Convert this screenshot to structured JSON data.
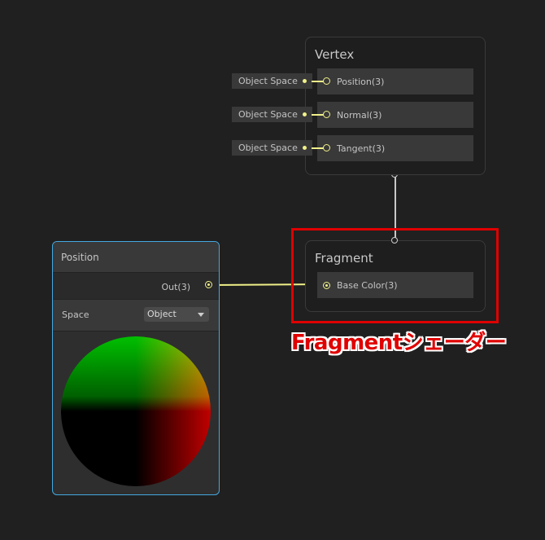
{
  "vertex_node": {
    "title": "Vertex",
    "slots": [
      {
        "label": "Position(3)",
        "input": "Object Space"
      },
      {
        "label": "Normal(3)",
        "input": "Object Space"
      },
      {
        "label": "Tangent(3)",
        "input": "Object Space"
      }
    ]
  },
  "fragment_node": {
    "title": "Fragment",
    "slots": [
      {
        "label": "Base Color(3)"
      }
    ]
  },
  "position_node": {
    "title": "Position",
    "output": "Out(3)",
    "space_label": "Space",
    "space_value": "Object"
  },
  "annotation": {
    "text": "Fragmentシェーダー",
    "color": "#e00000"
  },
  "colors": {
    "wire": "#f0f08a",
    "selection": "#44a8e0"
  }
}
